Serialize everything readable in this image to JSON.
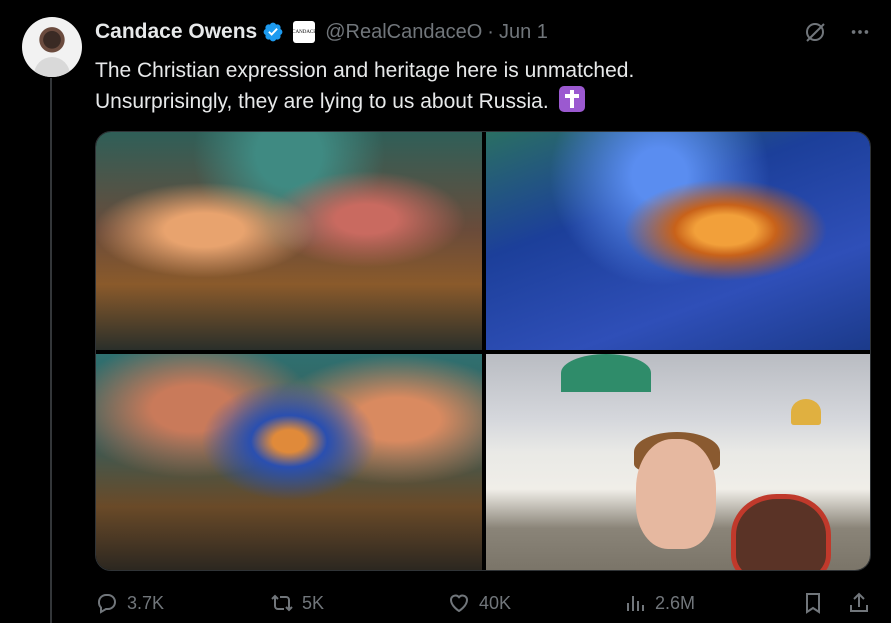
{
  "author": {
    "name": "Candace Owens",
    "handle": "@RealCandaceO",
    "separator": "·",
    "date": "Jun 1",
    "affiliate_badge_text": "CANDACE"
  },
  "tweet": {
    "line1": "The Christian expression and heritage here is unmatched.",
    "line2": "Unsurprisingly, they are lying to us about Russia."
  },
  "icons": {
    "grok": "grok-icon",
    "more": "more-icon",
    "emoji": "latin-cross-emoji"
  },
  "media": {
    "count": 4
  },
  "actions": {
    "replies": "3.7K",
    "reposts": "5K",
    "likes": "40K",
    "views": "2.6M"
  },
  "colors": {
    "background": "#000000",
    "text": "#e7e9ea",
    "secondary": "#71767b",
    "verified": "#1d9bf0",
    "emoji_purple": "#9b59d0"
  }
}
